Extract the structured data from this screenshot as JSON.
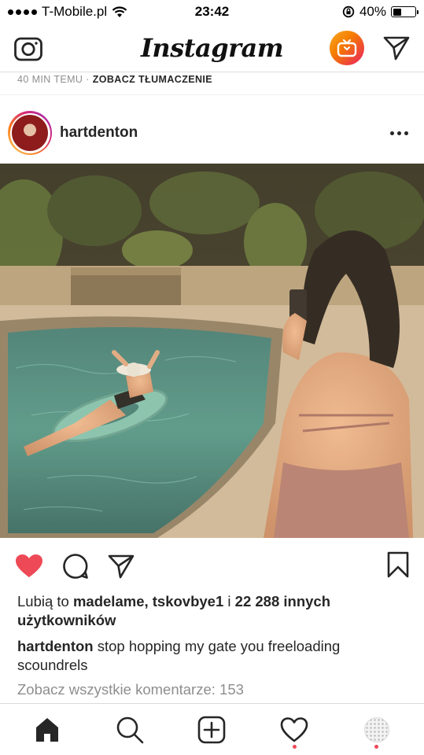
{
  "status_bar": {
    "carrier": "T-Mobile.pl",
    "time": "23:42",
    "battery": "40%",
    "battery_level": 0.4
  },
  "header": {
    "logo": "Instagram",
    "icons": [
      "camera-icon",
      "igtv-icon",
      "direct-send-icon"
    ]
  },
  "previous_post": {
    "time_ago": "40 MIN TEMU",
    "separator": "·",
    "translate_label": "ZOBACZ TŁUMACZENIE"
  },
  "post": {
    "username": "hartdenton",
    "actions": {
      "like_icon": "heart-filled-icon",
      "like_color": "#ed4956",
      "comment_icon": "comment-icon",
      "share_icon": "send-icon",
      "save_icon": "bookmark-icon"
    },
    "likes": {
      "prefix": "Lubią to",
      "names": "madelame, tskovbye1",
      "conjunction": "i",
      "others": "22 288 innych użytkowników"
    },
    "caption": {
      "username": "hartdenton",
      "text": "stop hopping my gate you freeloading scoundrels"
    },
    "view_comments": "Zobacz wszystkie komentarze: 153"
  },
  "tab_bar": {
    "items": [
      "home-icon",
      "search-icon",
      "new-post-icon",
      "activity-icon",
      "profile-icon"
    ],
    "notification_color": "#ed4956"
  }
}
